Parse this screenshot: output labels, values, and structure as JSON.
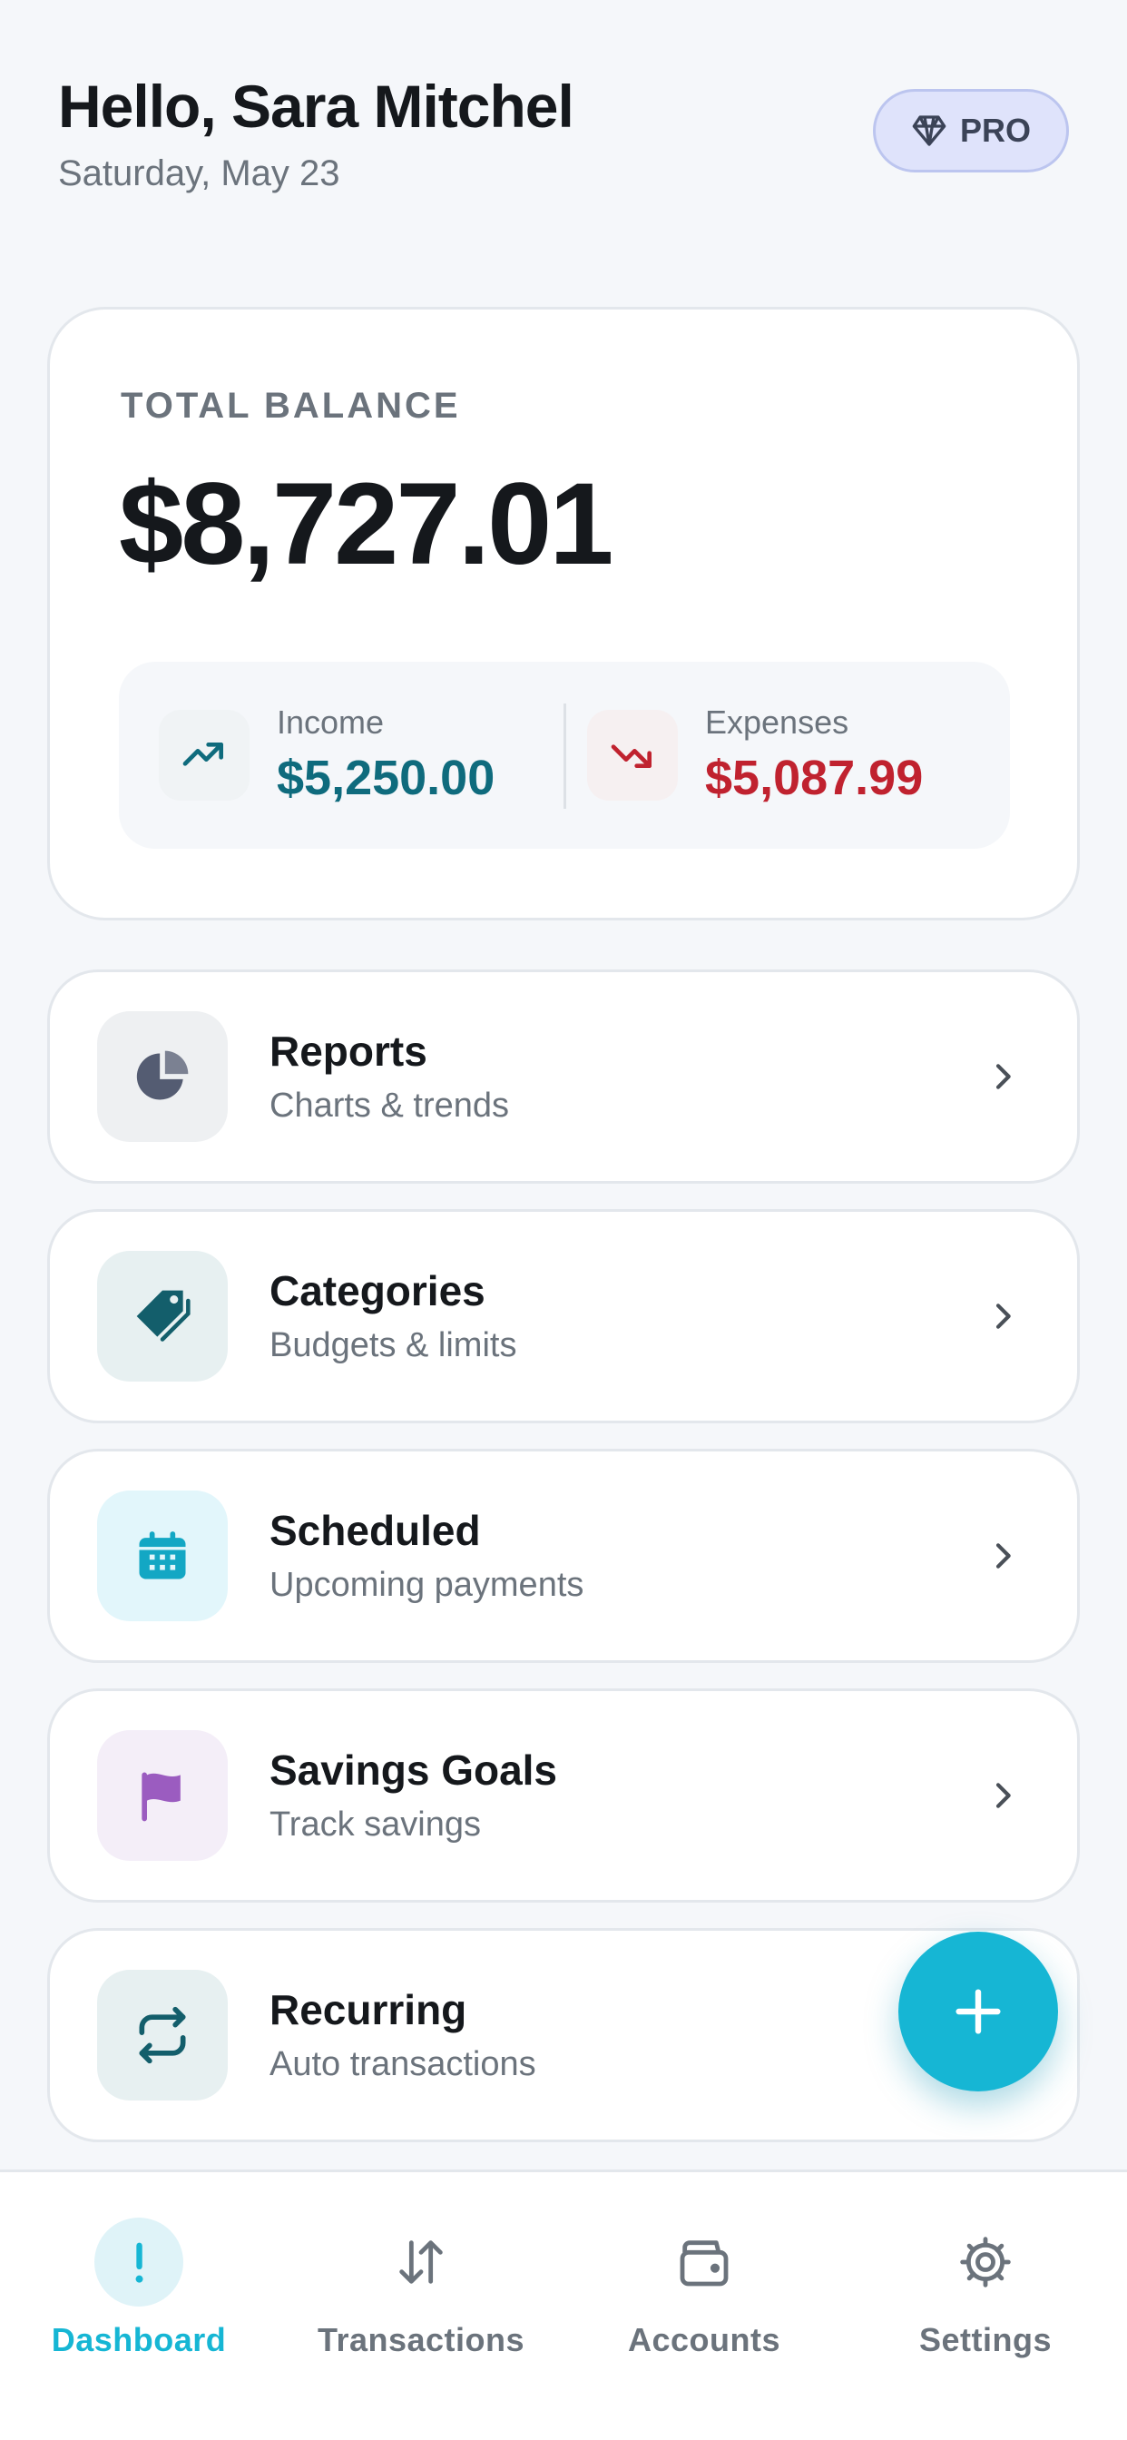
{
  "header": {
    "greeting": "Hello, Sara Mitchel",
    "date": "Saturday, May 23",
    "badge_label": "PRO",
    "badge_icon": "diamond-icon"
  },
  "balance": {
    "label": "TOTAL BALANCE",
    "value": "$8,727.01",
    "income": {
      "label": "Income",
      "value": "$5,250.00",
      "icon": "trend-up-icon",
      "color": "#0f6b7d"
    },
    "expenses": {
      "label": "Expenses",
      "value": "$5,087.99",
      "icon": "trend-down-icon",
      "color": "#c0222f"
    }
  },
  "menu": {
    "items": [
      {
        "title": "Reports",
        "subtitle": "Charts & trends",
        "icon": "pie-chart-icon",
        "icon_color": "#545c72",
        "icon_bg": "#eef0f2"
      },
      {
        "title": "Categories",
        "subtitle": "Budgets & limits",
        "icon": "tag-icon",
        "icon_color": "#135e6b",
        "icon_bg": "#e7f0f1"
      },
      {
        "title": "Scheduled",
        "subtitle": "Upcoming payments",
        "icon": "calendar-icon",
        "icon_color": "#13a7c4",
        "icon_bg": "#e2f6fb"
      },
      {
        "title": "Savings Goals",
        "subtitle": "Track savings",
        "icon": "flag-icon",
        "icon_color": "#9b5cc0",
        "icon_bg": "#f4eef8"
      },
      {
        "title": "Recurring",
        "subtitle": "Auto transactions",
        "icon": "repeat-icon",
        "icon_color": "#135e6b",
        "icon_bg": "#e7f0f1"
      }
    ]
  },
  "fab": {
    "icon": "plus-icon",
    "color": "#16b6d4"
  },
  "nav": {
    "items": [
      {
        "label": "Dashboard",
        "icon": "exclamation-icon",
        "active": true
      },
      {
        "label": "Transactions",
        "icon": "arrows-updown-icon",
        "active": false
      },
      {
        "label": "Accounts",
        "icon": "wallet-icon",
        "active": false
      },
      {
        "label": "Settings",
        "icon": "gear-icon",
        "active": false
      }
    ]
  }
}
